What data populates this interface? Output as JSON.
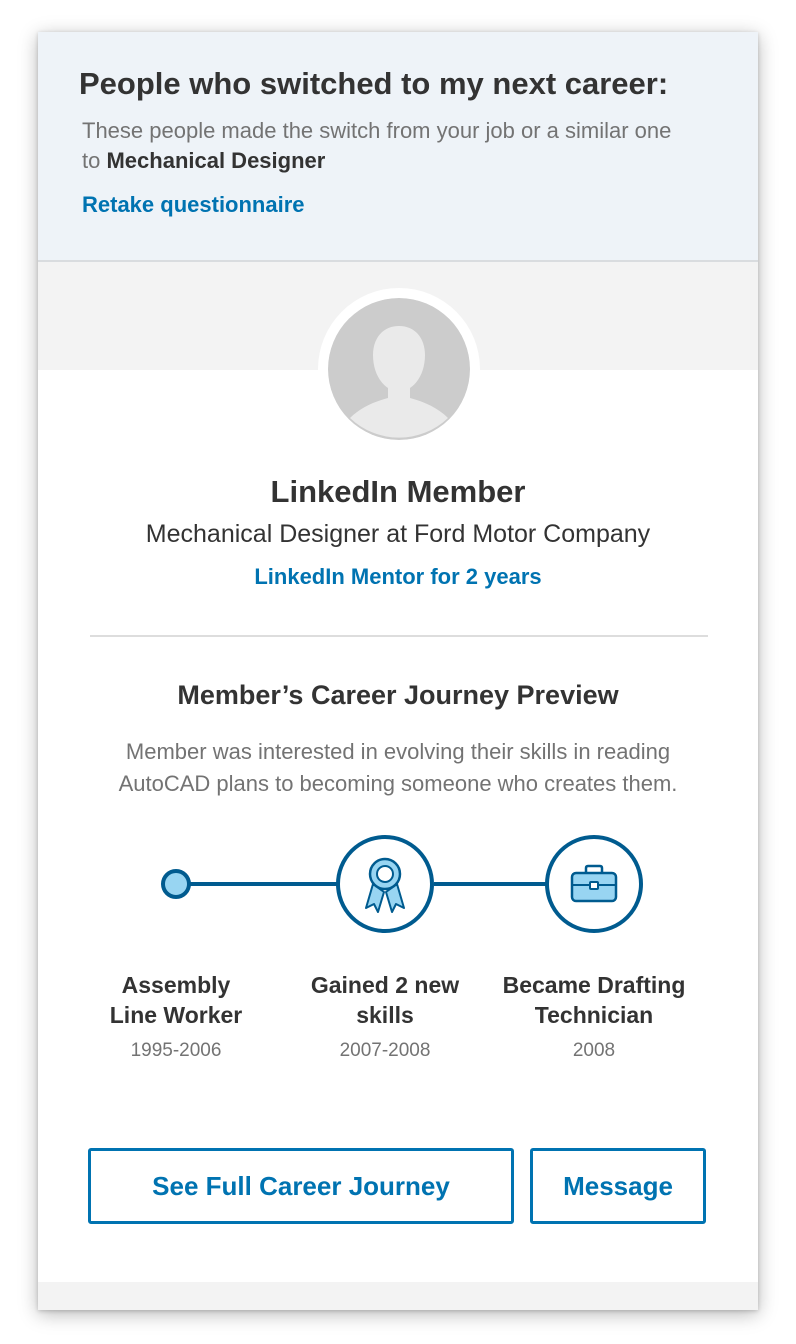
{
  "header": {
    "title": "People who switched to my next career:",
    "subtitle_prefix": "These people made the switch from your job or a similar one to ",
    "subtitle_target": "Mechanical Designer",
    "retake_link": "Retake questionnaire"
  },
  "member": {
    "avatar_icon": "person-silhouette-icon",
    "name": "LinkedIn Member",
    "role": "Mechanical Designer at Ford Motor Company",
    "mentor": "LinkedIn Mentor for 2 years"
  },
  "journey": {
    "title": "Member’s Career Journey Preview",
    "description": "Member was interested in evolving their skills in reading AutoCAD plans to becoming someone who creates them.",
    "milestones": [
      {
        "label_line1": "Assembly",
        "label_line2": "Line Worker",
        "years": "1995-2006",
        "icon": "dot-icon"
      },
      {
        "label_line1": "Gained 2 new",
        "label_line2": "skills",
        "years": "2007-2008",
        "icon": "award-ribbon-icon"
      },
      {
        "label_line1": "Became Drafting",
        "label_line2": "Technician",
        "years": "2008",
        "icon": "briefcase-icon"
      }
    ]
  },
  "actions": {
    "full_journey_label": "See Full Career Journey",
    "message_label": "Message"
  },
  "colors": {
    "accent": "#0073b1",
    "timeline": "#005b8f",
    "icon_fill": "#98d5f2",
    "header_bg": "#eef3f8",
    "text_dark": "#333333",
    "text_muted": "#737373"
  }
}
